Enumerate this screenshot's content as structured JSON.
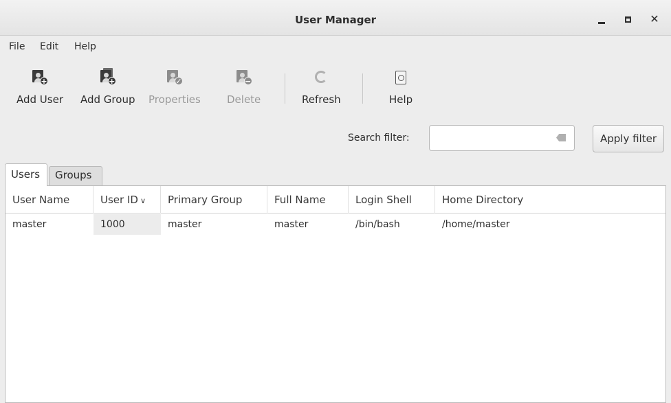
{
  "window": {
    "title": "User Manager"
  },
  "menu": {
    "items": [
      "File",
      "Edit",
      "Help"
    ]
  },
  "toolbar": {
    "add_user": "Add User",
    "add_group": "Add Group",
    "properties": "Properties",
    "delete": "Delete",
    "refresh": "Refresh",
    "help": "Help"
  },
  "search": {
    "label": "Search filter:",
    "value": "",
    "placeholder": "",
    "apply_label": "Apply filter"
  },
  "tabs": {
    "users": "Users",
    "groups": "Groups"
  },
  "table": {
    "columns": [
      "User Name",
      "User ID",
      "Primary Group",
      "Full Name",
      "Login Shell",
      "Home Directory"
    ],
    "sort_indicator": "∨",
    "rows": [
      [
        "master",
        "1000",
        "master",
        "master",
        "/bin/bash",
        "/home/master"
      ]
    ]
  }
}
